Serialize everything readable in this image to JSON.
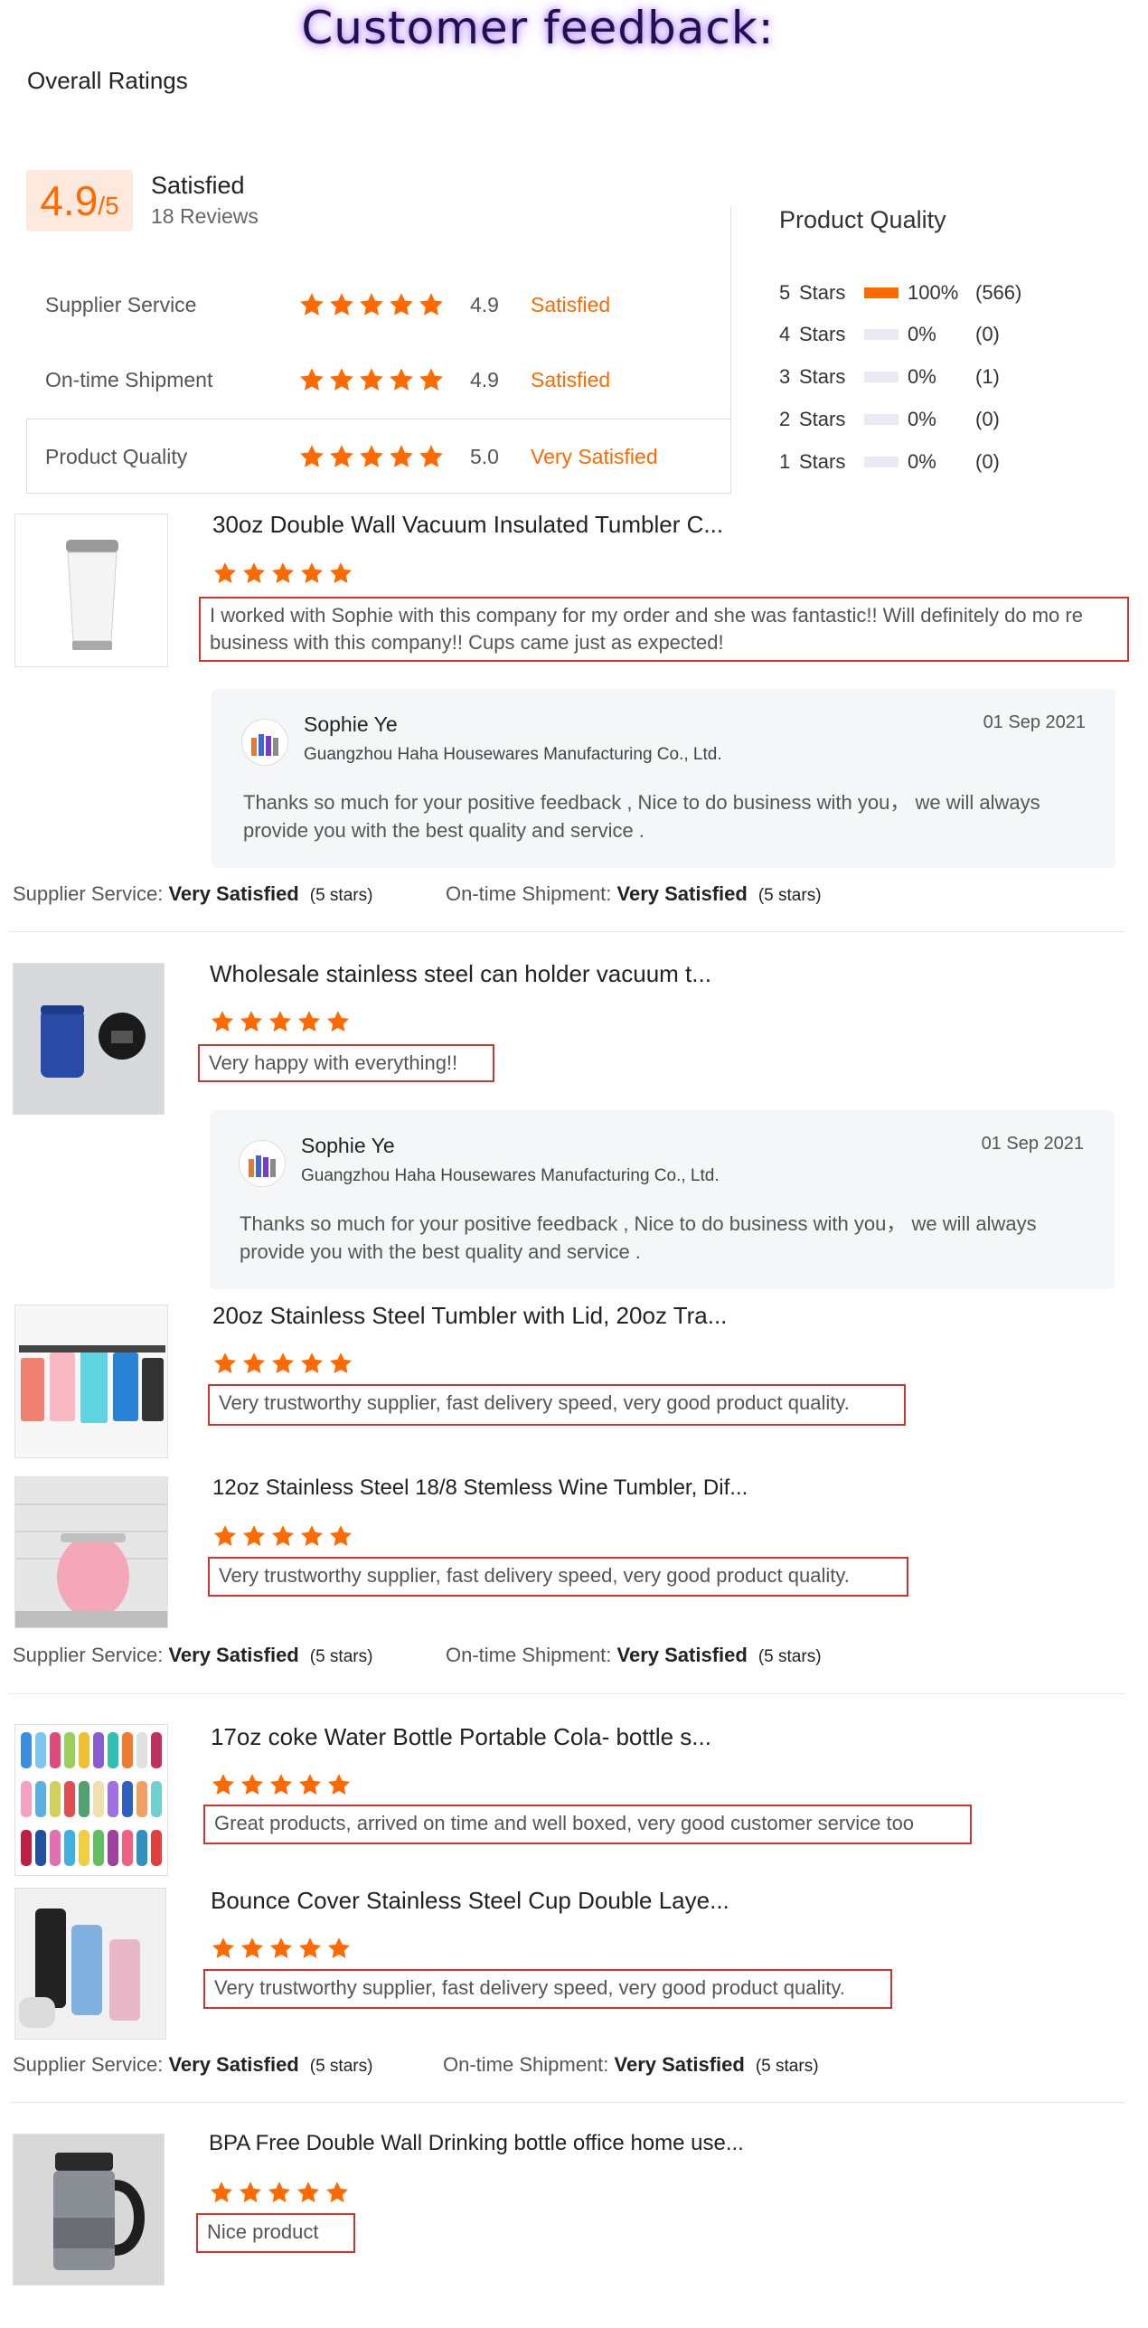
{
  "header": {
    "title": "Customer feedback:",
    "overall_label": "Overall Ratings"
  },
  "overall": {
    "score": "4.9",
    "out_of": "/5",
    "label": "Satisfied",
    "reviews": "18 Reviews"
  },
  "categories": [
    {
      "label": "Supplier Service",
      "score": "4.9",
      "status": "Satisfied",
      "rating": 4.9
    },
    {
      "label": "On-time Shipment",
      "score": "4.9",
      "status": "Satisfied",
      "rating": 4.9
    },
    {
      "label": "Product Quality",
      "score": "5.0",
      "status": "Very Satisfied",
      "rating": 5.0
    }
  ],
  "distribution": {
    "title": "Product Quality",
    "rows": [
      {
        "n": "5",
        "label": "Stars",
        "pct": "100%",
        "count": "(566)",
        "fill": 100
      },
      {
        "n": "4",
        "label": "Stars",
        "pct": "0%",
        "count": "(0)",
        "fill": 0
      },
      {
        "n": "3",
        "label": "Stars",
        "pct": "0%",
        "count": "(1)",
        "fill": 0
      },
      {
        "n": "2",
        "label": "Stars",
        "pct": "0%",
        "count": "(0)",
        "fill": 0
      },
      {
        "n": "1",
        "label": "Stars",
        "pct": "0%",
        "count": "(0)",
        "fill": 0
      }
    ]
  },
  "reviews": [
    {
      "product": "30oz Double Wall Vacuum Insulated Tumbler C...",
      "rating": 5,
      "text": "I worked with Sophie with this company for my order and she was fantastic!! Will definitely do mo re business with this company!! Cups came just as expected!"
    },
    {
      "product": "Wholesale stainless steel can holder vacuum t...",
      "rating": 5,
      "text": "Very happy with everything!!"
    },
    {
      "product": "20oz Stainless Steel Tumbler with Lid, 20oz Tra...",
      "rating": 5,
      "text": "Very trustworthy supplier, fast delivery speed, very good product quality."
    },
    {
      "product": "12oz Stainless Steel 18/8 Stemless Wine Tumbler, Dif...",
      "rating": 5,
      "text": "Very trustworthy supplier, fast delivery speed, very good product quality."
    },
    {
      "product": "17oz coke Water Bottle Portable Cola- bottle s...",
      "rating": 5,
      "text": "Great products, arrived on time and well boxed, very good customer service too"
    },
    {
      "product": "Bounce Cover Stainless Steel Cup Double Laye...",
      "rating": 5,
      "text": "Very trustworthy supplier, fast delivery speed, very good product quality."
    },
    {
      "product": "BPA Free Double Wall Drinking bottle office home use...",
      "rating": 5,
      "text": "Nice product"
    }
  ],
  "reply": {
    "name": "Sophie Ye",
    "date": "01 Sep 2021",
    "company": "Guangzhou Haha Housewares Manufacturing Co., Ltd.",
    "text": "Thanks so much for your positive feedback , Nice to do business with you， we will always provide you with the best quality and service ."
  },
  "meta": {
    "ss_label": "Supplier Service:",
    "os_label": "On-time Shipment:",
    "value": "Very Satisfied",
    "stars": "(5 stars)"
  },
  "colors": {
    "accent": "#ff6a00",
    "highlight_border": "#d0342c"
  }
}
